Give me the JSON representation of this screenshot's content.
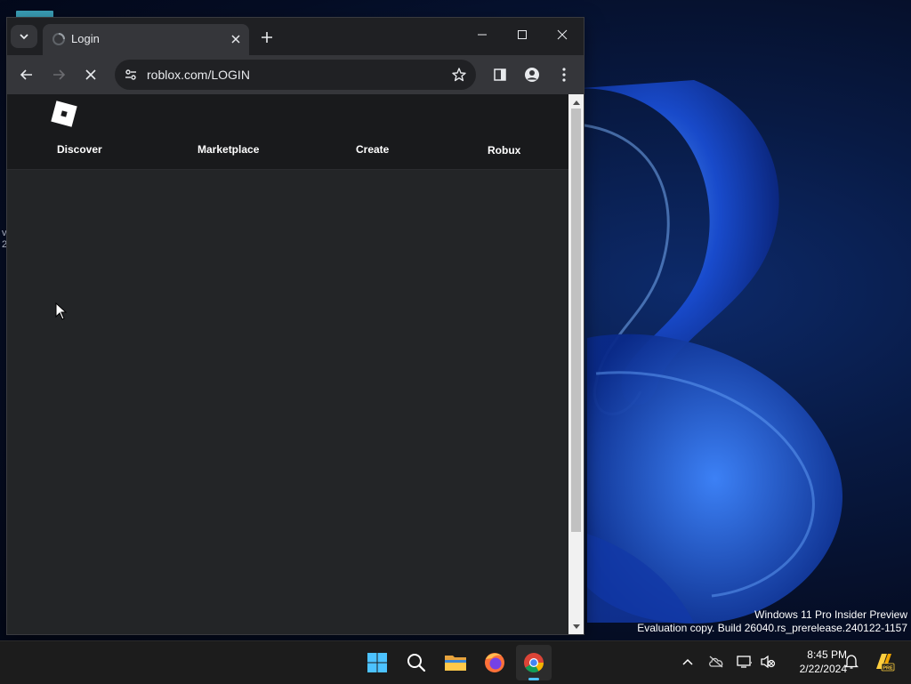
{
  "desktop": {
    "watermark_line1": "Windows 11 Pro Insider Preview",
    "watermark_line2": "Evaluation copy. Build 26040.rs_prerelease.240122-1157"
  },
  "browser": {
    "tab": {
      "title": "Login",
      "favicon": "loading-spinner-icon"
    },
    "address": {
      "url": "roblox.com/LOGIN"
    },
    "state": "loading"
  },
  "page": {
    "nav": [
      {
        "label": "Discover"
      },
      {
        "label": "Marketplace"
      },
      {
        "label": "Create"
      },
      {
        "label": "Robux"
      }
    ]
  },
  "taskbar": {
    "apps": [
      "start-icon",
      "search-icon",
      "file-explorer-icon",
      "firefox-icon",
      "chrome-icon"
    ],
    "active_app": "chrome-icon",
    "clock": {
      "time": "8:45 PM",
      "date": "2/22/2024"
    }
  },
  "colors": {
    "accent": "#4cc2ff",
    "page_bg": "#232527",
    "header_bg": "#191a1c"
  }
}
